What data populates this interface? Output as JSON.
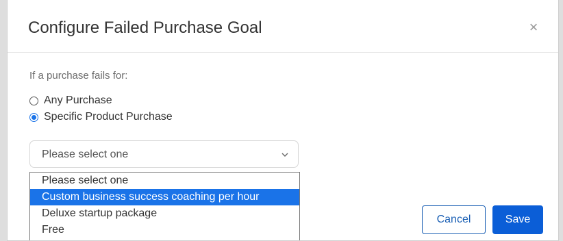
{
  "modal": {
    "title": "Configure Failed Purchase Goal",
    "close_symbol": "×"
  },
  "form": {
    "prompt": "If a purchase fails for:",
    "radios": [
      {
        "label": "Any Purchase",
        "checked": false
      },
      {
        "label": "Specific Product Purchase",
        "checked": true
      }
    ],
    "select": {
      "value": "Please select one",
      "options": [
        "Please select one",
        "Custom business success coaching per hour",
        "Deluxe startup package",
        "Free"
      ],
      "highlighted_option": "Custom business success coaching per hour"
    }
  },
  "actions": {
    "cancel_label": "Cancel",
    "save_label": "Save"
  },
  "colors": {
    "accent": "#1a73e8",
    "primary_button": "#0b5ed7"
  },
  "icons": {
    "close": "close-icon",
    "select": "chevron-down-icon"
  }
}
